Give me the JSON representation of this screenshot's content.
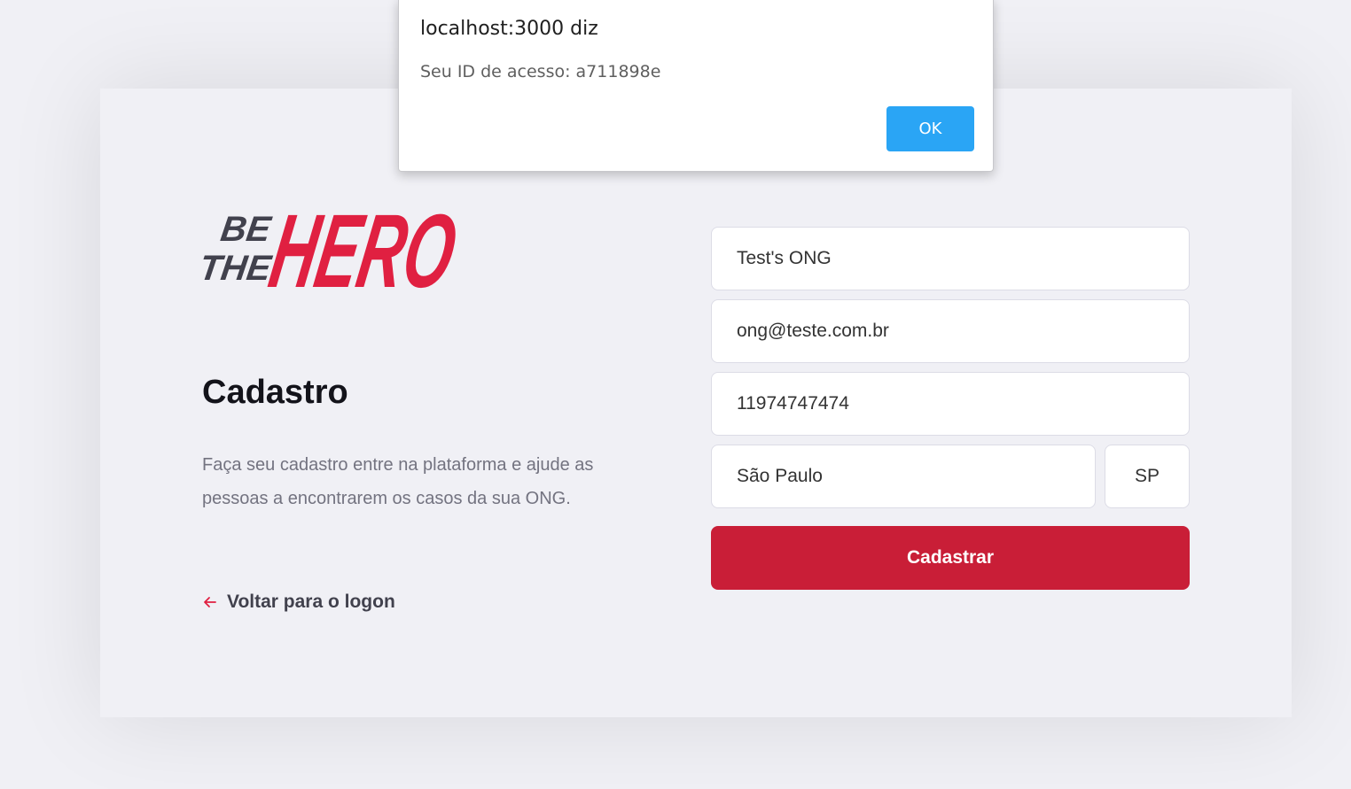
{
  "dialog": {
    "title": "localhost:3000 diz",
    "message": "Seu ID de acesso: a711898e",
    "ok_label": "OK"
  },
  "logo": {
    "line1": "BE",
    "line2": "THE",
    "word": "HERO"
  },
  "register": {
    "title": "Cadastro",
    "description": "Faça seu cadastro entre na plataforma e ajude as pessoas a encontrarem os casos da sua ONG.",
    "back_label": "Voltar para o logon"
  },
  "form": {
    "name": "Test's ONG",
    "email": "ong@teste.com.br",
    "whatsapp": "11974747474",
    "city": "São Paulo",
    "uf": "SP",
    "submit_label": "Cadastrar"
  },
  "colors": {
    "brand_red": "#e02041",
    "button_red": "#c91e37",
    "ok_blue": "#2aa5f5",
    "background": "#f0f0f5"
  }
}
